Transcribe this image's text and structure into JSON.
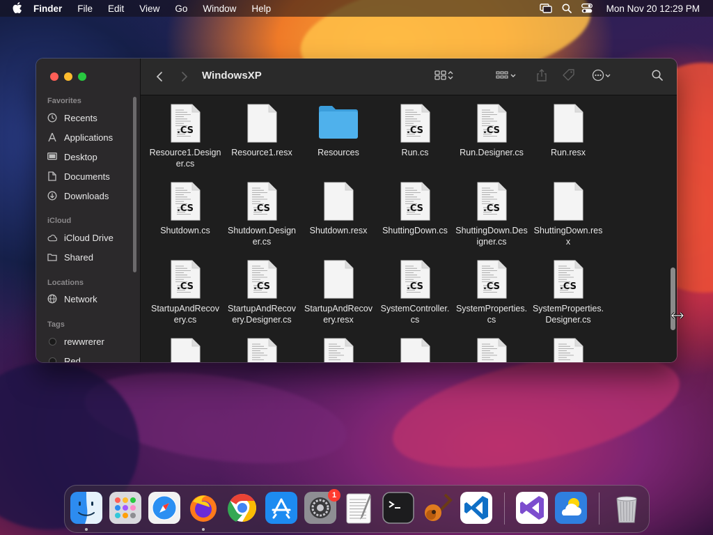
{
  "menubar": {
    "app_name": "Finder",
    "menus": [
      "File",
      "Edit",
      "View",
      "Go",
      "Window",
      "Help"
    ],
    "clock": "Mon Nov 20  12:29 PM"
  },
  "window": {
    "title": "WindowsXP"
  },
  "sidebar": {
    "favorites_heading": "Favorites",
    "favorites": [
      {
        "label": "Recents",
        "icon": "clock-icon"
      },
      {
        "label": "Applications",
        "icon": "applications-icon"
      },
      {
        "label": "Desktop",
        "icon": "desktop-icon"
      },
      {
        "label": "Documents",
        "icon": "document-icon"
      },
      {
        "label": "Downloads",
        "icon": "download-icon"
      }
    ],
    "icloud_heading": "iCloud",
    "icloud": [
      {
        "label": "iCloud Drive",
        "icon": "cloud-icon"
      },
      {
        "label": "Shared",
        "icon": "shared-folder-icon"
      }
    ],
    "locations_heading": "Locations",
    "locations": [
      {
        "label": "Network",
        "icon": "network-icon"
      }
    ],
    "tags_heading": "Tags",
    "tags": [
      {
        "label": "rewwrerer",
        "color": "#1a1a1a"
      },
      {
        "label": "Red",
        "color": "#1a1a1a"
      }
    ]
  },
  "files": [
    {
      "name": "Resource1.Designer.cs",
      "kind": "cs-lined"
    },
    {
      "name": "Resource1.resx",
      "kind": "blank"
    },
    {
      "name": "Resources",
      "kind": "folder"
    },
    {
      "name": "Run.cs",
      "kind": "cs-lined"
    },
    {
      "name": "Run.Designer.cs",
      "kind": "cs-lined"
    },
    {
      "name": "Run.resx",
      "kind": "blank"
    },
    {
      "name": "Shutdown.cs",
      "kind": "cs-lined"
    },
    {
      "name": "Shutdown.Designer.cs",
      "kind": "cs-lined"
    },
    {
      "name": "Shutdown.resx",
      "kind": "blank"
    },
    {
      "name": "ShuttingDown.cs",
      "kind": "cs-lined"
    },
    {
      "name": "ShuttingDown.Designer.cs",
      "kind": "cs-lined"
    },
    {
      "name": "ShuttingDown.resx",
      "kind": "blank"
    },
    {
      "name": "StartupAndRecovery.cs",
      "kind": "cs-lined"
    },
    {
      "name": "StartupAndRecovery.Designer.cs",
      "kind": "cs-lined"
    },
    {
      "name": "StartupAndRecovery.resx",
      "kind": "blank"
    },
    {
      "name": "SystemController.cs",
      "kind": "cs-lined"
    },
    {
      "name": "SystemProperties.cs",
      "kind": "cs-lined"
    },
    {
      "name": "SystemProperties.Designer.cs",
      "kind": "cs-lined"
    },
    {
      "name": "",
      "kind": "blank"
    },
    {
      "name": "",
      "kind": "lined"
    },
    {
      "name": "",
      "kind": "lined"
    },
    {
      "name": "",
      "kind": "blank"
    },
    {
      "name": "",
      "kind": "lined"
    },
    {
      "name": "",
      "kind": "lined"
    }
  ],
  "file_badge_text": ".CS",
  "dock": {
    "apps": [
      {
        "name": "Finder",
        "icon": "finder-icon",
        "running": true
      },
      {
        "name": "Launchpad",
        "icon": "launchpad-icon",
        "running": false
      },
      {
        "name": "Safari",
        "icon": "safari-icon",
        "running": false
      },
      {
        "name": "Firefox",
        "icon": "firefox-icon",
        "running": true
      },
      {
        "name": "Chrome",
        "icon": "chrome-icon",
        "running": false
      },
      {
        "name": "App Store",
        "icon": "app-store-icon",
        "running": false
      },
      {
        "name": "System Settings",
        "icon": "settings-icon",
        "running": false,
        "badge": "1"
      },
      {
        "name": "TextEdit",
        "icon": "textedit-icon",
        "running": false
      },
      {
        "name": "Terminal",
        "icon": "terminal-icon",
        "running": false
      },
      {
        "name": "GarageBand",
        "icon": "guitar-icon",
        "running": false
      },
      {
        "name": "Visual Studio Code",
        "icon": "vscode-icon",
        "running": false
      },
      {
        "name": "Visual Studio",
        "icon": "visual-studio-icon",
        "running": false
      },
      {
        "name": "Weather",
        "icon": "weather-icon",
        "running": false
      },
      {
        "name": "Trash",
        "icon": "trash-icon",
        "running": false
      }
    ]
  },
  "colors": {
    "close": "#ff5f57",
    "minimize": "#febc2e",
    "zoom": "#28c840",
    "folder": "#4fb1ec"
  }
}
